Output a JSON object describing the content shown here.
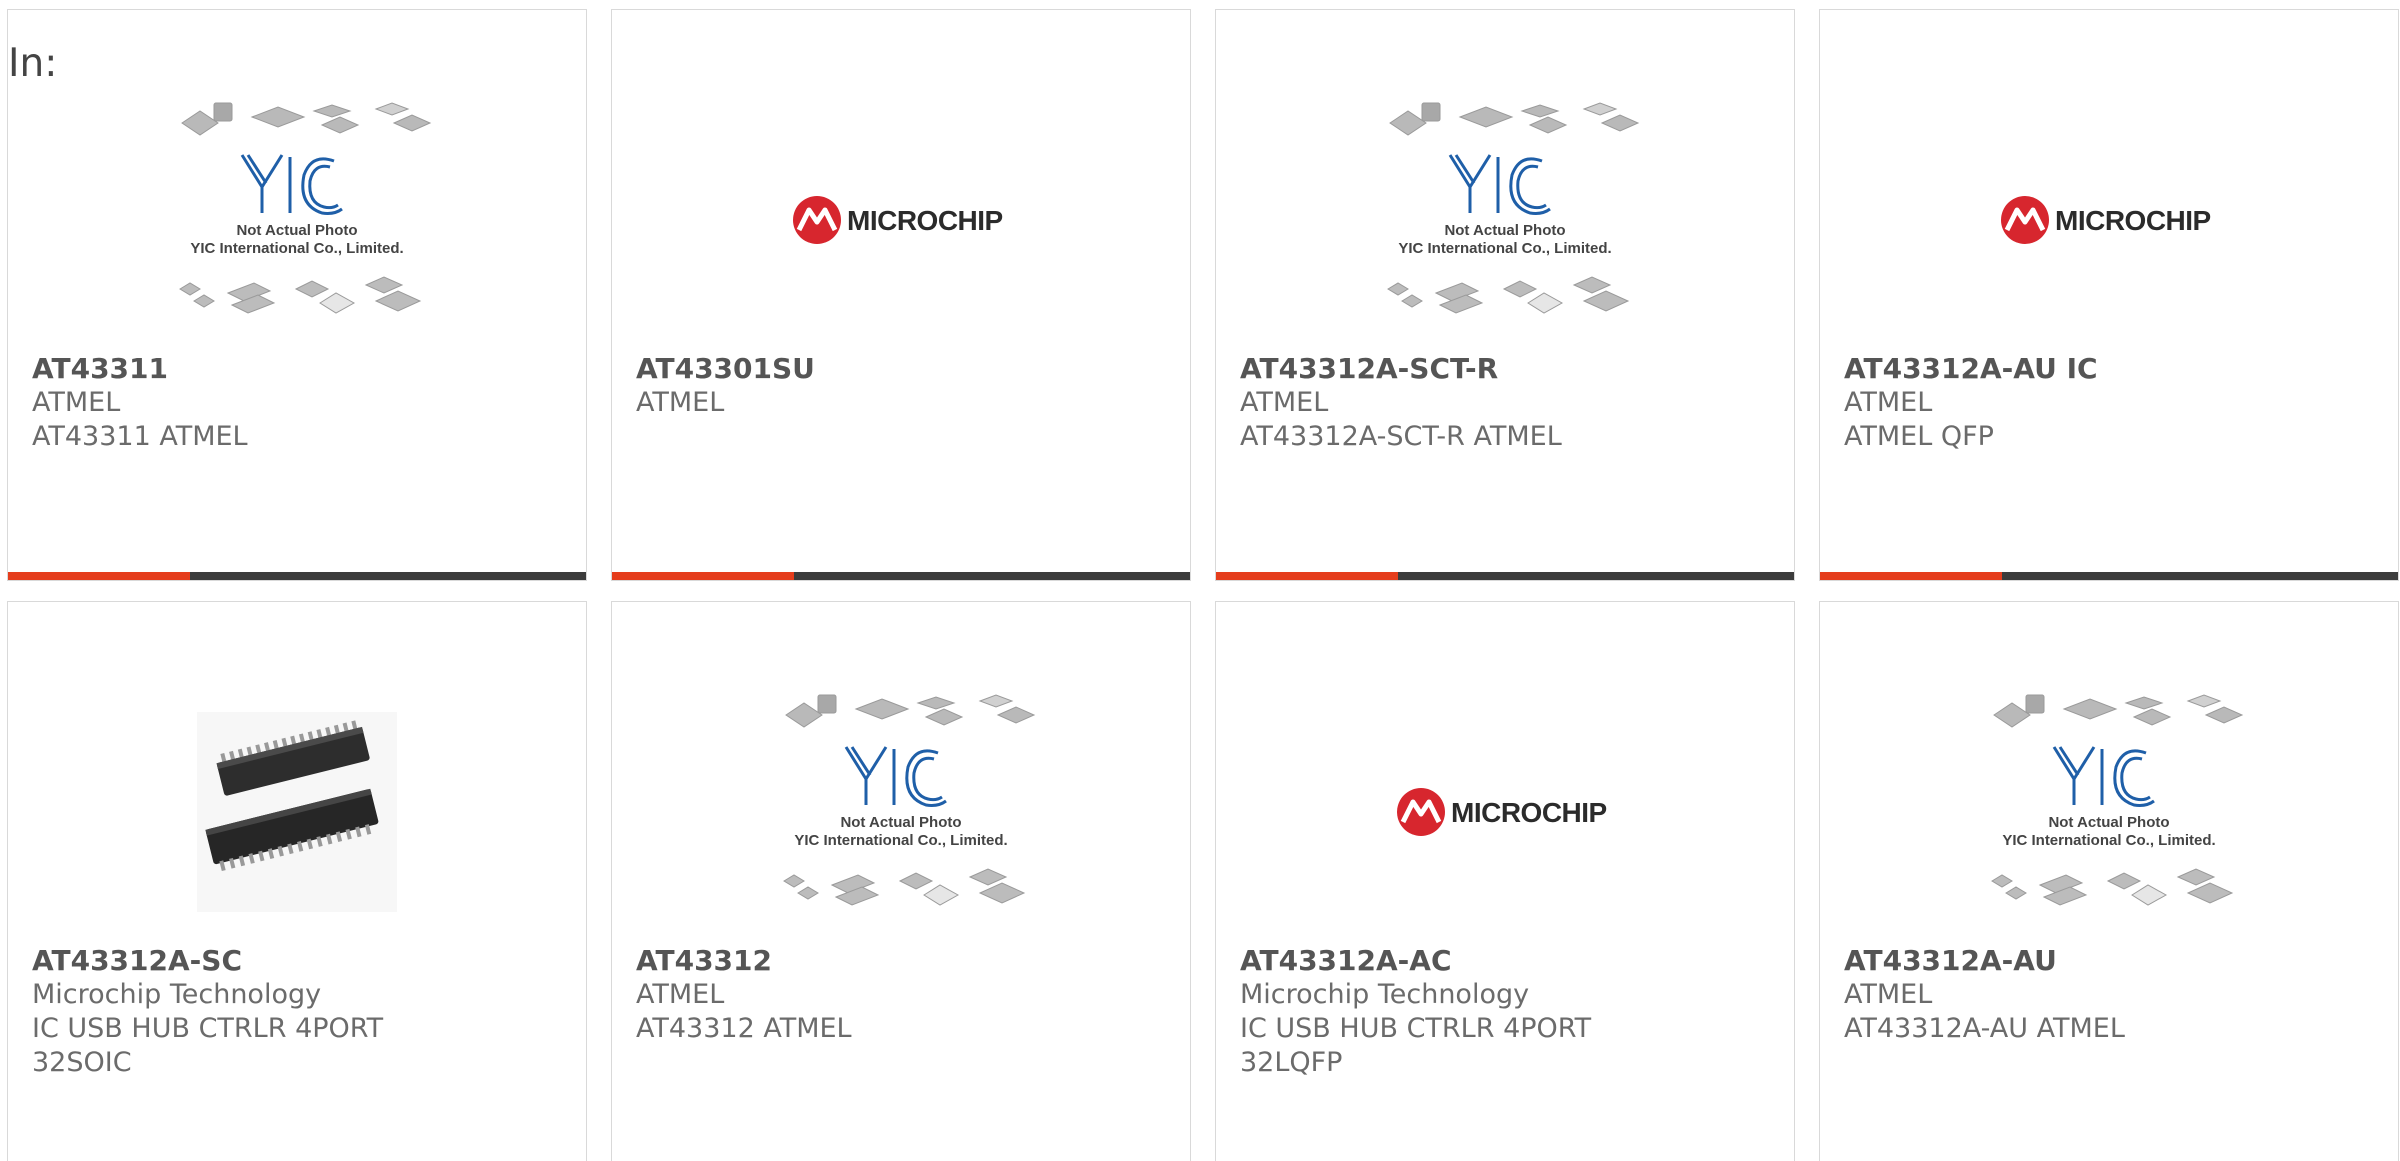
{
  "filter": {
    "label": "In:"
  },
  "colors": {
    "accent": "#e53d1c",
    "bar": "#3c3c3c",
    "microchip_red": "#d7262e",
    "yic_blue": "#1f5fa8"
  },
  "placeholder_image": {
    "line1": "Not Actual Photo",
    "line2": "YIC International Co., Limited.",
    "logo_text": "YIC"
  },
  "microchip_logo": {
    "text": "MICROCHIP"
  },
  "products": [
    {
      "part_number": "AT43311",
      "manufacturer": "ATMEL",
      "description": "AT43311 ATMEL",
      "image": "yic-placeholder"
    },
    {
      "part_number": "AT43301SU",
      "manufacturer": "ATMEL",
      "description": "",
      "image": "microchip-logo"
    },
    {
      "part_number": "AT43312A-SCT-R",
      "manufacturer": "ATMEL",
      "description": "AT43312A-SCT-R ATMEL",
      "image": "yic-placeholder"
    },
    {
      "part_number": "AT43312A-AU IC",
      "manufacturer": "ATMEL",
      "description": "ATMEL QFP",
      "image": "microchip-logo"
    },
    {
      "part_number": "AT43312A-SC",
      "manufacturer": "Microchip Technology",
      "description": "IC USB HUB CTRLR 4PORT",
      "description2": "32SOIC",
      "image": "soic-chips"
    },
    {
      "part_number": "AT43312",
      "manufacturer": "ATMEL",
      "description": "AT43312 ATMEL",
      "image": "yic-placeholder"
    },
    {
      "part_number": "AT43312A-AC",
      "manufacturer": "Microchip Technology",
      "description": "IC USB HUB CTRLR 4PORT",
      "description2": "32LQFP",
      "image": "microchip-logo"
    },
    {
      "part_number": "AT43312A-AU",
      "manufacturer": "ATMEL",
      "description": "AT43312A-AU ATMEL",
      "image": "yic-placeholder"
    }
  ]
}
